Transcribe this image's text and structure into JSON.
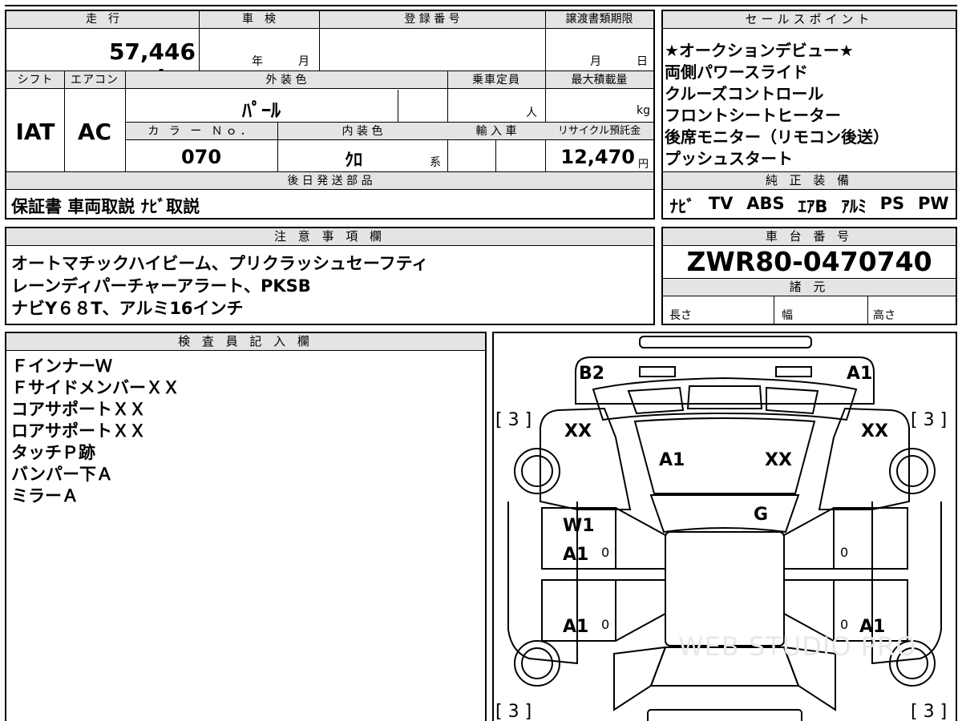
{
  "vehicle_info": {
    "mileage_label": "走　行",
    "mileage_value": "57,446 km",
    "inspection_label": "車　検",
    "inspection_year_unit": "年",
    "inspection_month_unit": "月",
    "registration_label": "登 録 番 号",
    "transfer_deadline_label": "譲渡書類期限",
    "transfer_month_unit": "月",
    "transfer_day_unit": "日",
    "shift_label": "シフト",
    "shift_value": "IAT",
    "ac_label": "エアコン",
    "ac_value": "AC",
    "exterior_color_label": "外 装 色",
    "exterior_color_value": "ﾊﾟｰﾙ",
    "capacity_label": "乗車定員",
    "capacity_unit": "人",
    "max_load_label": "最大積載量",
    "max_load_unit": "kg",
    "color_no_label": "カ ラ ー Ｎｏ．",
    "color_no_value": "070",
    "interior_color_label": "内 装 色",
    "interior_color_value": "ｸﾛ",
    "interior_color_unit": "系",
    "import_label": "輸 入 車",
    "recycle_label": "リサイクル預託金",
    "recycle_value": "12,470",
    "recycle_unit": "円",
    "later_parts_label": "後 日 発 送 部 品",
    "later_parts_value": "保証書 車両取説 ﾅﾋﾞ取説"
  },
  "sales_points": {
    "title": "セールスポイント",
    "items": [
      "★オークションデビュー★",
      "両側パワースライド",
      "クルーズコントロール",
      "フロントシートヒーター",
      "後席モニター（リモコン後送）",
      "プッシュスタート"
    ]
  },
  "equipment": {
    "title": "純 正 装 備",
    "items": [
      "ﾅﾋﾞ",
      "TV",
      "ABS",
      "ｴｱB",
      "ｱﾙﾐ",
      "PS",
      "PW"
    ]
  },
  "notes": {
    "title": "注 意 事 項 欄",
    "lines": [
      "オートマチックハイビーム、プリクラッシュセーフティ",
      "レーンディパーチャーアラート、PKSB",
      "ナビY６８T、アルミ16インチ"
    ]
  },
  "chassis": {
    "title": "車 台 番 号",
    "value": "ZWR80-0470740",
    "specs_title": "諸 元",
    "length_label": "長さ",
    "width_label": "幅",
    "height_label": "高さ"
  },
  "inspector": {
    "title": "検 査 員 記 入 欄",
    "lines": [
      "ＦインナーＷ",
      "ＦサイドメンバーＸＸ",
      "コアサポートＸＸ",
      "ロアサポートＸＸ",
      "タッチＰ跡",
      "バンパー下Ａ",
      "ミラーＡ"
    ]
  },
  "diagram": {
    "b2": "B2",
    "a1_top": "A1",
    "bracket_tl": "[ 3 ]",
    "bracket_tr": "[ 3 ]",
    "bracket_bl": "[ 3 ]",
    "bracket_br": "[ 3 ]",
    "xx_left": "XX",
    "xx_right": "XX",
    "hood_a1": "A1",
    "hood_xx": "XX",
    "glass_g": "G",
    "door_fl_w1": "W1",
    "door_fl_a1": "A1",
    "door_fl_zero": "0",
    "door_fr_zero": "0",
    "door_rl_a1": "A1",
    "door_rl_zero": "0",
    "door_rr_zero": "0",
    "door_rr_a1": "A1",
    "watermark": "WEB STUDIO PRO"
  }
}
